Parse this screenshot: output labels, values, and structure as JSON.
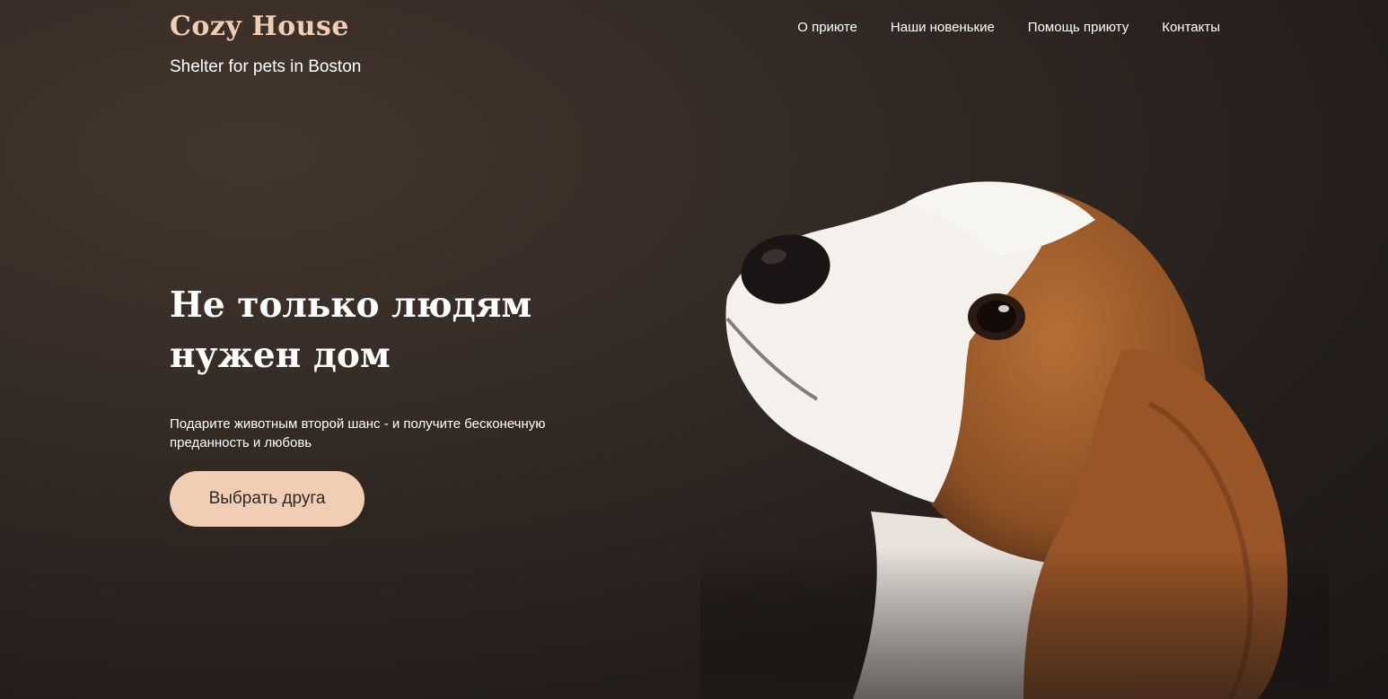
{
  "header": {
    "logo_title": "Cozy House",
    "logo_subtitle": "Shelter for pets in Boston"
  },
  "nav": {
    "items": [
      {
        "label": "О приюте"
      },
      {
        "label": "Наши новенькие"
      },
      {
        "label": "Помощь приюту"
      },
      {
        "label": "Контакты"
      }
    ]
  },
  "hero": {
    "title_line1": "Не только людям",
    "title_line2": "нужен дом",
    "text_line1": "Подарите животным второй шанс - и получите бесконечную",
    "text_line2": "преданность и любовь",
    "cta_label": "Выбрать друга"
  },
  "colors": {
    "accent": "#f1cdb3",
    "background_dark": "#251e1b",
    "button_text": "#292929"
  },
  "image": {
    "subject": "beagle-puppy-photo"
  }
}
